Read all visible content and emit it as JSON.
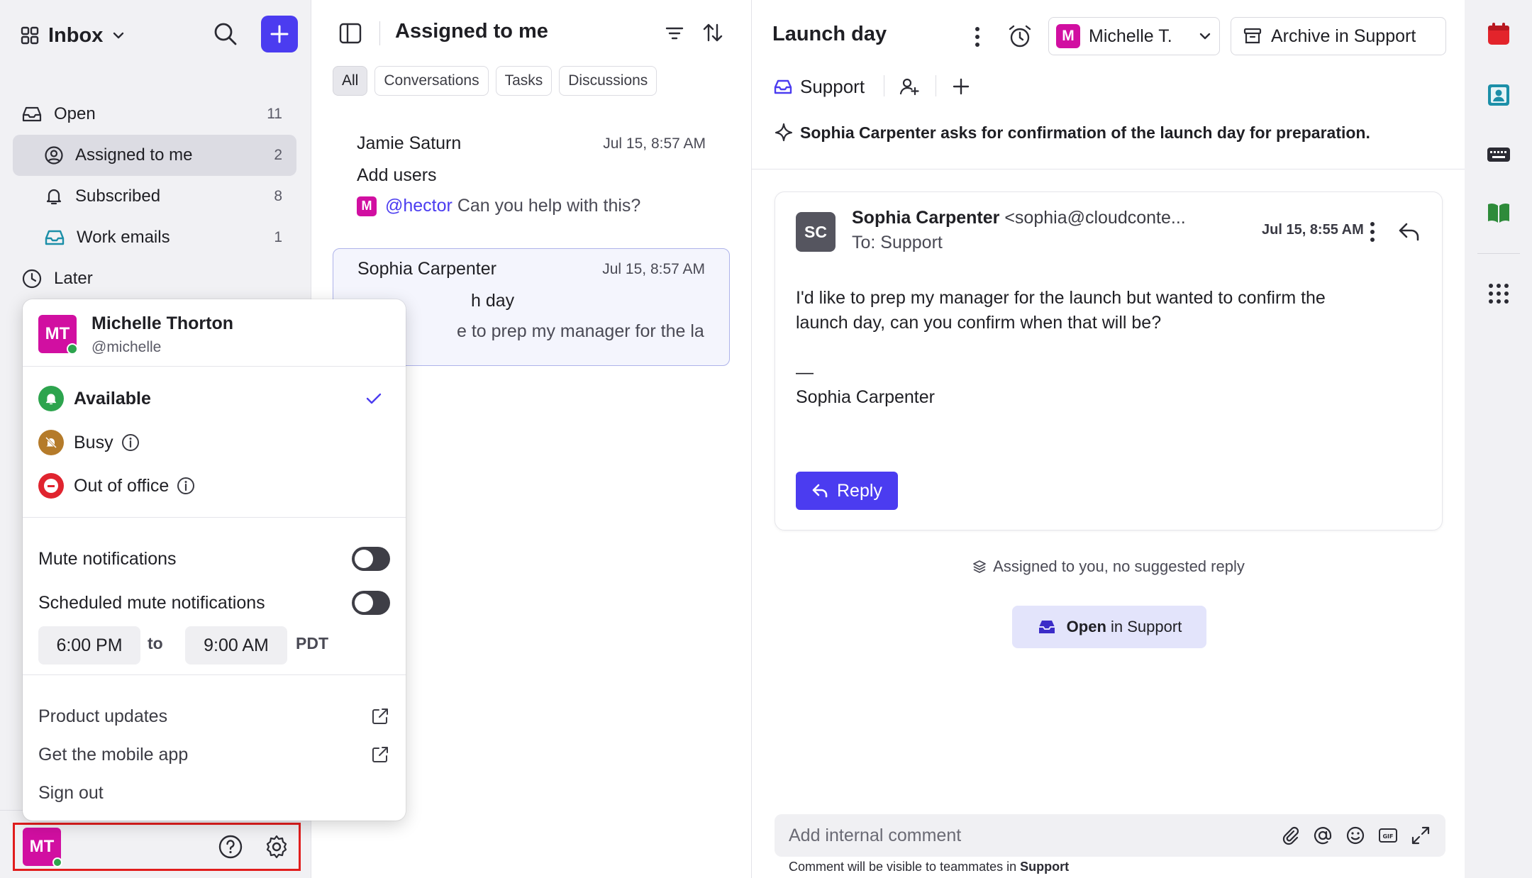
{
  "sidebar": {
    "inbox_title": "Inbox",
    "items": [
      {
        "label": "Open",
        "count": "11"
      },
      {
        "label": "Assigned to me",
        "count": "2"
      },
      {
        "label": "Subscribed",
        "count": "8"
      },
      {
        "label": "Work emails",
        "count": "1"
      },
      {
        "label": "Later",
        "count": ""
      }
    ],
    "footer_avatar": "MT"
  },
  "list": {
    "title": "Assigned to me",
    "filters": [
      "All",
      "Conversations",
      "Tasks",
      "Discussions"
    ],
    "conversations": [
      {
        "sender": "Jamie Saturn",
        "time": "Jul 15, 8:57 AM",
        "subject": "Add users",
        "mention": "@hector",
        "preview": " Can you help with this?",
        "avatar": "M"
      },
      {
        "sender": "Sophia Carpenter",
        "time": "Jul 15, 8:57 AM",
        "subject": "h day",
        "preview": "e to prep my manager for the laun..."
      }
    ]
  },
  "thread": {
    "title": "Launch day",
    "assignee": "Michelle T.",
    "assignee_avatar": "M",
    "archive_label": "Archive in Support",
    "team_tag": "Support",
    "summary": "Sophia Carpenter asks for confirmation of the launch day for preparation.",
    "message": {
      "avatar": "SC",
      "from_name": "Sophia Carpenter",
      "from_email": "<sophia@cloudconte...",
      "to": "To: Support",
      "time": "Jul 15, 8:55 AM",
      "body_line1": "I'd like to prep my manager for the launch but wanted to confirm the",
      "body_line2": "launch day, can you confirm when that will be?",
      "sig_dash": "—",
      "signature": "Sophia Carpenter",
      "reply_label": "Reply"
    },
    "assigned_note": "Assigned to you, no suggested reply",
    "open_bold": "Open",
    "open_rest": " in Support",
    "comment_placeholder": "Add internal comment",
    "comment_hint_prefix": "Comment will be visible to teammates in ",
    "comment_hint_bold": "Support"
  },
  "popup": {
    "avatar": "MT",
    "name": "Michelle Thorton",
    "handle": "@michelle",
    "statuses": [
      {
        "label": "Available",
        "color": "#2da44e"
      },
      {
        "label": "Busy",
        "color": "#b57b2a"
      },
      {
        "label": "Out of office",
        "color": "#e0242f"
      }
    ],
    "mute_label": "Mute notifications",
    "scheduled_label": "Scheduled mute notifications",
    "from_time": "6:00 PM",
    "to_word": "to",
    "to_time": "9:00 AM",
    "timezone": "PDT",
    "links": [
      "Product updates",
      "Get the mobile app",
      "Sign out"
    ]
  },
  "colors": {
    "accent": "#4b3cf0",
    "avatar": "#d10fa1",
    "online": "#2da44e",
    "highlight": "#e11d1d"
  }
}
